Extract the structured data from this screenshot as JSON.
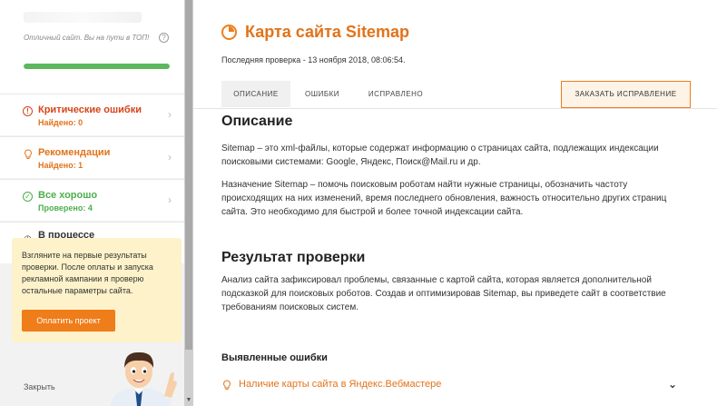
{
  "sidebar": {
    "site_status": "Отличный сайт. Вы на пути в ТОП!",
    "help_icon": "?",
    "progress": 1.0,
    "items": [
      {
        "title": "Критические ошибки",
        "sub": "Найдено: 0",
        "color": "#d6451a",
        "sub_color": "#e2731a",
        "icon": "!"
      },
      {
        "title": "Рекомендации",
        "sub": "Найдено: 1",
        "color": "#e2731a",
        "sub_color": "#e2731a",
        "icon": "💡"
      },
      {
        "title": "Все хорошо",
        "sub": "Проверено: 4",
        "color": "#4cae4c",
        "sub_color": "#4cae4c",
        "icon": "✓"
      },
      {
        "title": "В процессе",
        "sub": "",
        "color": "#333333",
        "sub_color": "#333333",
        "icon": "◷"
      }
    ],
    "chevron": "›",
    "popup": {
      "text": "Взгляните на первые результаты проверки. После оплаты и запуска рекламной кампании я проверю остальные параметры сайта.",
      "button": "Оплатить проект"
    },
    "close": "Закрыть",
    "scroll_down_arrow": "▼"
  },
  "main": {
    "title": "Карта сайта Sitemap",
    "last_check": "Последняя проверка - 13 ноября 2018, 08:06:54.",
    "tabs": [
      {
        "label": "ОПИСАНИЕ",
        "active": true
      },
      {
        "label": "ОШИБКИ",
        "active": false
      },
      {
        "label": "ИСПРАВЛЕНО",
        "active": false
      }
    ],
    "order_button": "ЗАКАЗАТЬ ИСПРАВЛЕНИЕ",
    "description_heading": "Описание",
    "description_p1": "Sitemap – это xml-файлы, которые содержат информацию о страницах сайта, подлежащих индексации поисковыми системами: Google, Яндекс, Поиск@Mail.ru и др.",
    "description_p2": "Назначение Sitemap – помочь поисковым роботам найти нужные страницы, обозначить частоту происходящих на них изменений, время последнего обновления, важность относительно других страниц сайта. Это необходимо для быстрой и более точной индексации сайта.",
    "result_heading": "Результат проверки",
    "result_p": "Анализ сайта зафиксировал проблемы, связанные с картой сайта, которая является дополнительной подсказкой для поисковых роботов. Создав и оптимизировав Sitemap, вы приведете сайт в соответствие требованиям поисковых систем.",
    "issues_heading": "Выявленные ошибки",
    "issues": [
      {
        "label": "Наличие карты сайта в Яндекс.Вебмастере",
        "icon": "lightbulb-icon",
        "chevron": "⌄"
      }
    ],
    "accent": "#e2731a"
  }
}
